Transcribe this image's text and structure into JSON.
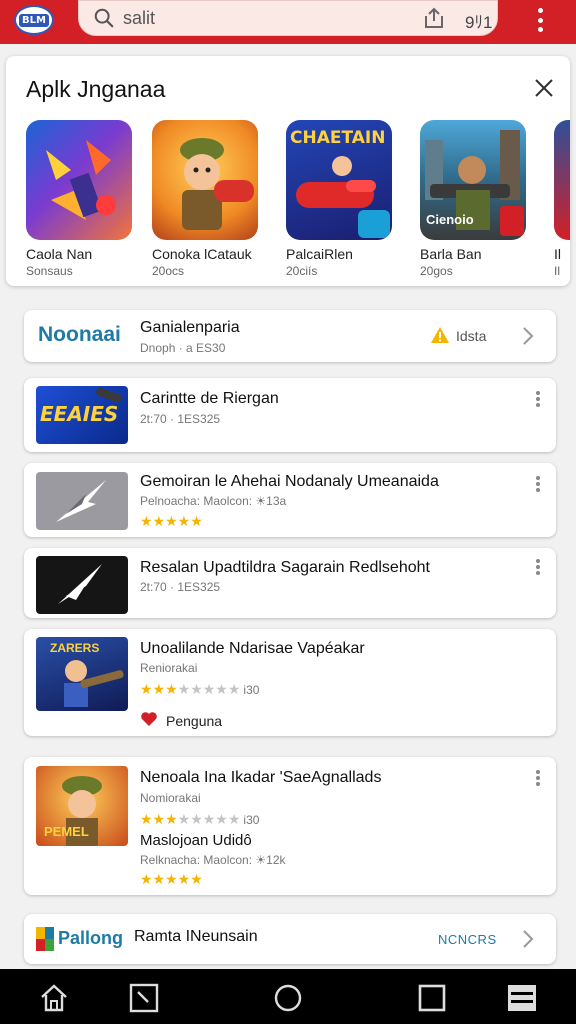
{
  "topbar": {
    "logo_text": "BLM",
    "search_text": "salit",
    "count_text": "9ﾘ1"
  },
  "featured": {
    "title": "Aplk Jnganaa",
    "tiles": [
      {
        "name": "Caola Nan",
        "sub": "Sonsaus"
      },
      {
        "name": "Conoka lCatauk",
        "sub": "20ocs"
      },
      {
        "name": "PalcaiRlen",
        "sub": "20ciís"
      },
      {
        "name": "Barla Ban",
        "sub": "20gos"
      },
      {
        "name": "Il",
        "sub": "Il"
      }
    ],
    "tile_art_texts": [
      "",
      "",
      "CHAETAIN",
      "Cienoio"
    ]
  },
  "promo": {
    "brand": "Noonaai",
    "title": "Ganialenparia",
    "meta": "Dnoph · a ES30",
    "badge": "Idsta"
  },
  "apps": [
    {
      "title": "Carintte de Riergan",
      "meta": "2t:70 · 1ES325",
      "thumb_text": "EEAIES"
    },
    {
      "title": "Gemoiran le Ahehai Nodanaly Umeanaida",
      "meta": "Pelnoacha: Maolcon: ☀13a",
      "stars": 5
    },
    {
      "title": "Resalan Upadtildra Sagarain Redlsehoht",
      "meta": "2t:70 · 1ES325"
    },
    {
      "title": "Unoalilande Ndarisae Vapéakar",
      "meta": "Reniorakai",
      "stars": 3,
      "review_count": "i30",
      "tag": "Penguna",
      "thumb_text": "ZARERS"
    },
    {
      "title": "Nenoala Ina Ikadar 'SaeAgnallads",
      "meta": "Nomiorakai",
      "stars": 3,
      "review_count": "i30",
      "extra_title": "Maslojoan Udidô",
      "extra_meta": "Relknacha: Maolcon: ☀12k",
      "extra_stars": 5,
      "thumb_text": "PEMEL"
    }
  ],
  "bottom_card": {
    "brand": "Pallong",
    "title": "Ramta INeunsain",
    "badge": "NCNCRS"
  },
  "colors": {
    "brand_red": "#d32027",
    "star": "#f4b400",
    "accent_blue": "#1f7aa5"
  },
  "icons": [
    "search-icon",
    "share-icon",
    "more-vert-icon",
    "close-icon",
    "chevron-right-icon",
    "warning-icon",
    "heart-icon",
    "home-icon",
    "back-icon",
    "circle-home-icon",
    "square-recents-icon",
    "menu-icon"
  ]
}
